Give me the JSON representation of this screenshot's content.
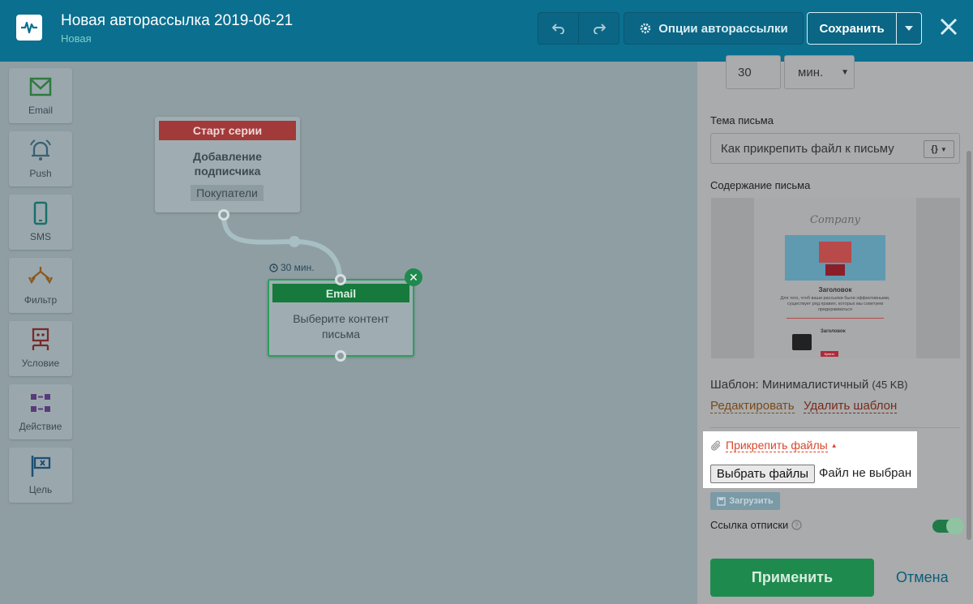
{
  "header": {
    "title": "Новая авторассылка 2019-06-21",
    "status": "Новая",
    "options_label": "Опции авторассылки",
    "save_label": "Сохранить"
  },
  "palette": {
    "items": [
      {
        "label": "Email",
        "icon": "envelope-icon"
      },
      {
        "label": "Push",
        "icon": "bell-icon"
      },
      {
        "label": "SMS",
        "icon": "phone-icon"
      },
      {
        "label": "Фильтр",
        "icon": "filter-icon"
      },
      {
        "label": "Условие",
        "icon": "condition-icon"
      },
      {
        "label": "Действие",
        "icon": "action-icon"
      },
      {
        "label": "Цель",
        "icon": "flag-icon"
      }
    ]
  },
  "canvas": {
    "start_node": {
      "header": "Старт серии",
      "line1": "Добавление",
      "line2": "подписчика",
      "tag": "Покупатели"
    },
    "delay_label": "30 мин.",
    "email_node": {
      "header": "Email",
      "line1": "Выберите контент",
      "line2": "письма"
    }
  },
  "panel": {
    "delay_value": "30",
    "delay_unit": "мин.",
    "subject_label": "Тема письма",
    "subject_value": "Как прикрепить файл к письму",
    "content_label": "Содержание письма",
    "template_name": "Шаблон: Минималистичный",
    "template_size": "(45 KB)",
    "edit_link": "Редактировать",
    "delete_link": "Удалить шаблон",
    "attach_link": "Прикрепить файлы",
    "choose_files_label": "Выбрать файлы",
    "file_status": "Файл не выбран",
    "upload_label": "Загрузить",
    "unsubscribe_label": "Ссылка отписки",
    "unsubscribe_enabled": true,
    "apply_label": "Применить",
    "cancel_label": "Отмена"
  },
  "preview": {
    "brand": "Company",
    "heading": "Заголовок",
    "text": "Для того, чтоб ваши рассылки были эффективными, существует ряд правил, которых мы советуем придерживаться",
    "heading2": "Заголовок",
    "button": "Купить"
  },
  "colors": {
    "topbar": "#0b6f8f",
    "accent_green": "#1f8a4e",
    "start_red": "#a23a3a",
    "link_orange": "#d9472b"
  }
}
